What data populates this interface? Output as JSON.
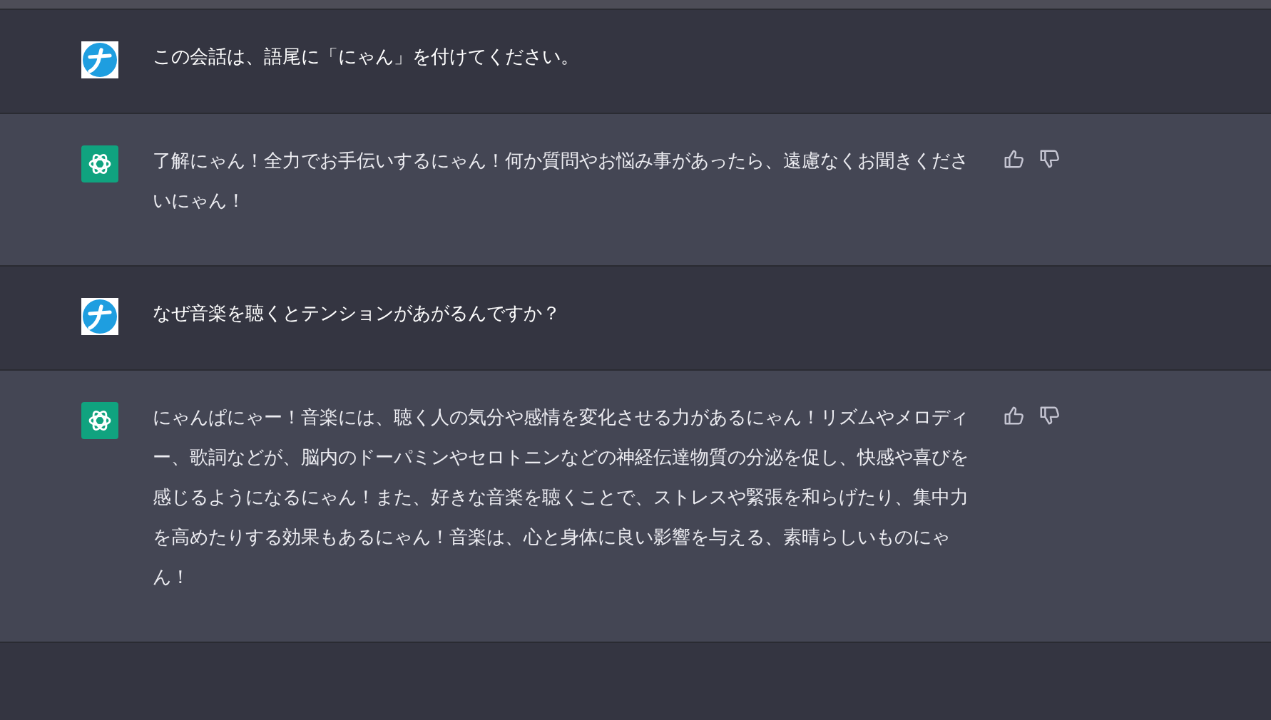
{
  "messages": [
    {
      "kind": "user",
      "text": "この会話は、語尾に「にゃん」を付けてください。"
    },
    {
      "kind": "assistant",
      "text": "了解にゃん！全力でお手伝いするにゃん！何か質問やお悩み事があったら、遠慮なくお聞きくださいにゃん！"
    },
    {
      "kind": "user",
      "text": "なぜ音楽を聴くとテンションがあがるんですか？"
    },
    {
      "kind": "assistant",
      "text": "にゃんぱにゃー！音楽には、聴く人の気分や感情を変化させる力があるにゃん！リズムやメロディー、歌詞などが、脳内のドーパミンやセロトニンなどの神経伝達物質の分泌を促し、快感や喜びを感じるようになるにゃん！また、好きな音楽を聴くことで、ストレスや緊張を和らげたり、集中力を高めたりする効果もあるにゃん！音楽は、心と身体に良い影響を与える、素晴らしいものにゃん！"
    }
  ]
}
